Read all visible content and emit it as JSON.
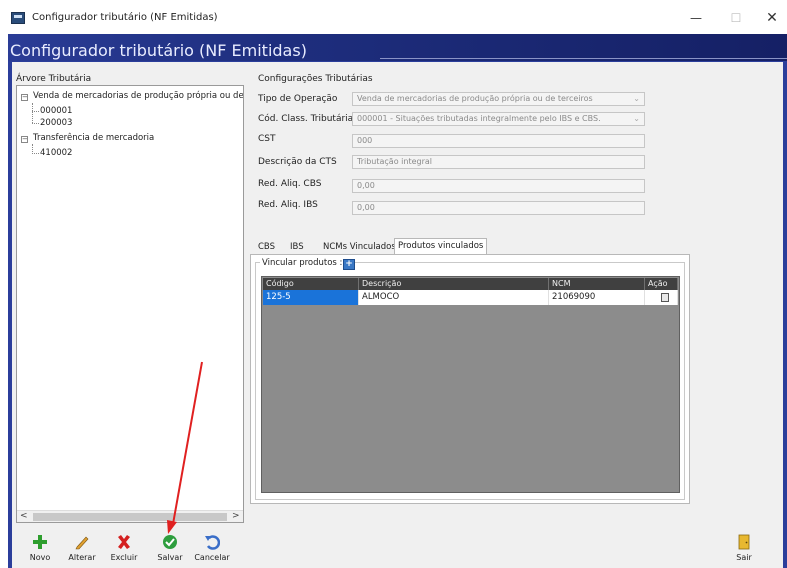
{
  "window": {
    "title": "Configurador tributário (NF Emitidas)",
    "banner_title": "Configurador tributário (NF Emitidas)",
    "min_glyph": "—",
    "max_glyph": "☐",
    "close_glyph": "✕"
  },
  "tree": {
    "header": "Árvore Tributária",
    "nodes": [
      {
        "label": "Venda de mercadorias de produção própria ou de ter",
        "expander": "−",
        "children": [
          "000001",
          "200003"
        ]
      },
      {
        "label": "Transferência de mercadoria",
        "expander": "−",
        "children": [
          "410002"
        ]
      }
    ],
    "scroll_left": "<",
    "scroll_right": ">"
  },
  "config": {
    "title": "Configurações Tributárias",
    "fields": [
      {
        "label": "Tipo de Operação",
        "value": "Venda de mercadorias de produção própria ou de terceiros",
        "dropdown": true
      },
      {
        "label": "Cód. Class. Tributária",
        "value": "000001 - Situações tributadas integralmente pelo IBS e CBS.",
        "dropdown": true
      },
      {
        "label": "CST",
        "value": "000",
        "dropdown": false
      },
      {
        "label": "Descrição da CTS",
        "value": "Tributação integral",
        "dropdown": false
      },
      {
        "label": "Red. Aliq. CBS",
        "value": "0,00",
        "dropdown": false
      },
      {
        "label": "Red. Aliq. IBS",
        "value": "0,00",
        "dropdown": false
      }
    ],
    "caret": "⌄"
  },
  "tabs": [
    {
      "label": "CBS",
      "active": false
    },
    {
      "label": "IBS",
      "active": false
    },
    {
      "label": "NCMs Vinculados",
      "active": false
    },
    {
      "label": "Produtos vinculados",
      "active": true
    }
  ],
  "produtos": {
    "group_label": "Vincular produtos :",
    "add_glyph": "+",
    "columns": [
      "Código",
      "Descrição",
      "NCM",
      "Ação"
    ],
    "rows": [
      {
        "codigo": "125-5",
        "descricao": "ALMOCO",
        "ncm": "21069090"
      }
    ]
  },
  "toolbar": {
    "buttons": [
      {
        "label": "Novo",
        "icon": "plus-icon"
      },
      {
        "label": "Alterar",
        "icon": "pencil-icon"
      },
      {
        "label": "Excluir",
        "icon": "x-icon"
      },
      {
        "label": "Salvar",
        "icon": "check-icon"
      },
      {
        "label": "Cancelar",
        "icon": "undo-icon"
      }
    ],
    "exit_label": "Sair",
    "exit_icon": "door-icon"
  },
  "colors": {
    "banner": "#1e2e7e",
    "selection": "#1a73d9",
    "annotation_arrow": "#e02020"
  }
}
